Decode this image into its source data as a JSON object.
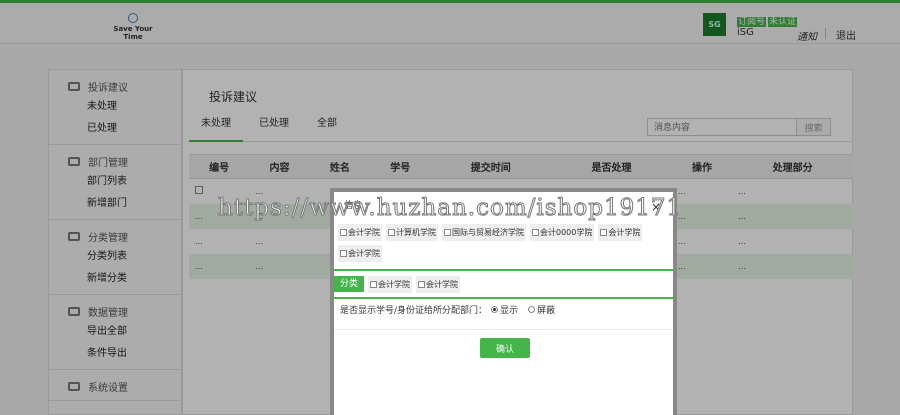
{
  "header": {
    "logo_text": "Save Your Time",
    "avatar_text": "SG",
    "badges": [
      "订阅号",
      "未认证"
    ],
    "username": "iSG",
    "notice": "通知",
    "logout": "退出"
  },
  "sidebar": [
    {
      "label": "投诉建议",
      "items": [
        "未处理",
        "已处理"
      ]
    },
    {
      "label": "部门管理",
      "items": [
        "部门列表",
        "新增部门"
      ]
    },
    {
      "label": "分类管理",
      "items": [
        "分类列表",
        "新增分类"
      ]
    },
    {
      "label": "数据管理",
      "items": [
        "导出全部",
        "条件导出"
      ]
    },
    {
      "label": "系统设置",
      "items": []
    }
  ],
  "main": {
    "title": "投诉建议",
    "tabs": [
      "未处理",
      "已处理",
      "全部"
    ],
    "search_placeholder": "消息内容",
    "search_button": "搜索",
    "columns": [
      "编号",
      "内容",
      "姓名",
      "学号",
      "提交时间",
      "是否处理",
      "操作",
      "处理部分"
    ],
    "rows": [
      [
        "",
        "...",
        "",
        "",
        "",
        "",
        "...",
        "..."
      ],
      [
        "...",
        "...",
        "",
        "",
        "",
        "",
        "...",
        "..."
      ],
      [
        "...",
        "...",
        "",
        "",
        "",
        "",
        "...",
        "..."
      ],
      [
        "...",
        "...",
        "",
        "",
        "",
        "",
        "...",
        "..."
      ]
    ]
  },
  "dialog": {
    "title": "信息",
    "close": "×",
    "options": [
      "会计学院",
      "计算机学院",
      "国际与贸易经济学院",
      "会计0000学院",
      "会计学院",
      "会计学院"
    ],
    "category_label": "分类",
    "category_options": [
      "会计学院",
      "会计学院"
    ],
    "show_question": "是否显示学号/身份证给所分配部门：",
    "radio_show": "显示",
    "radio_hide": "屏蔽",
    "confirm": "确认"
  },
  "watermark": "https://www.huzhan.com/ishop19171"
}
